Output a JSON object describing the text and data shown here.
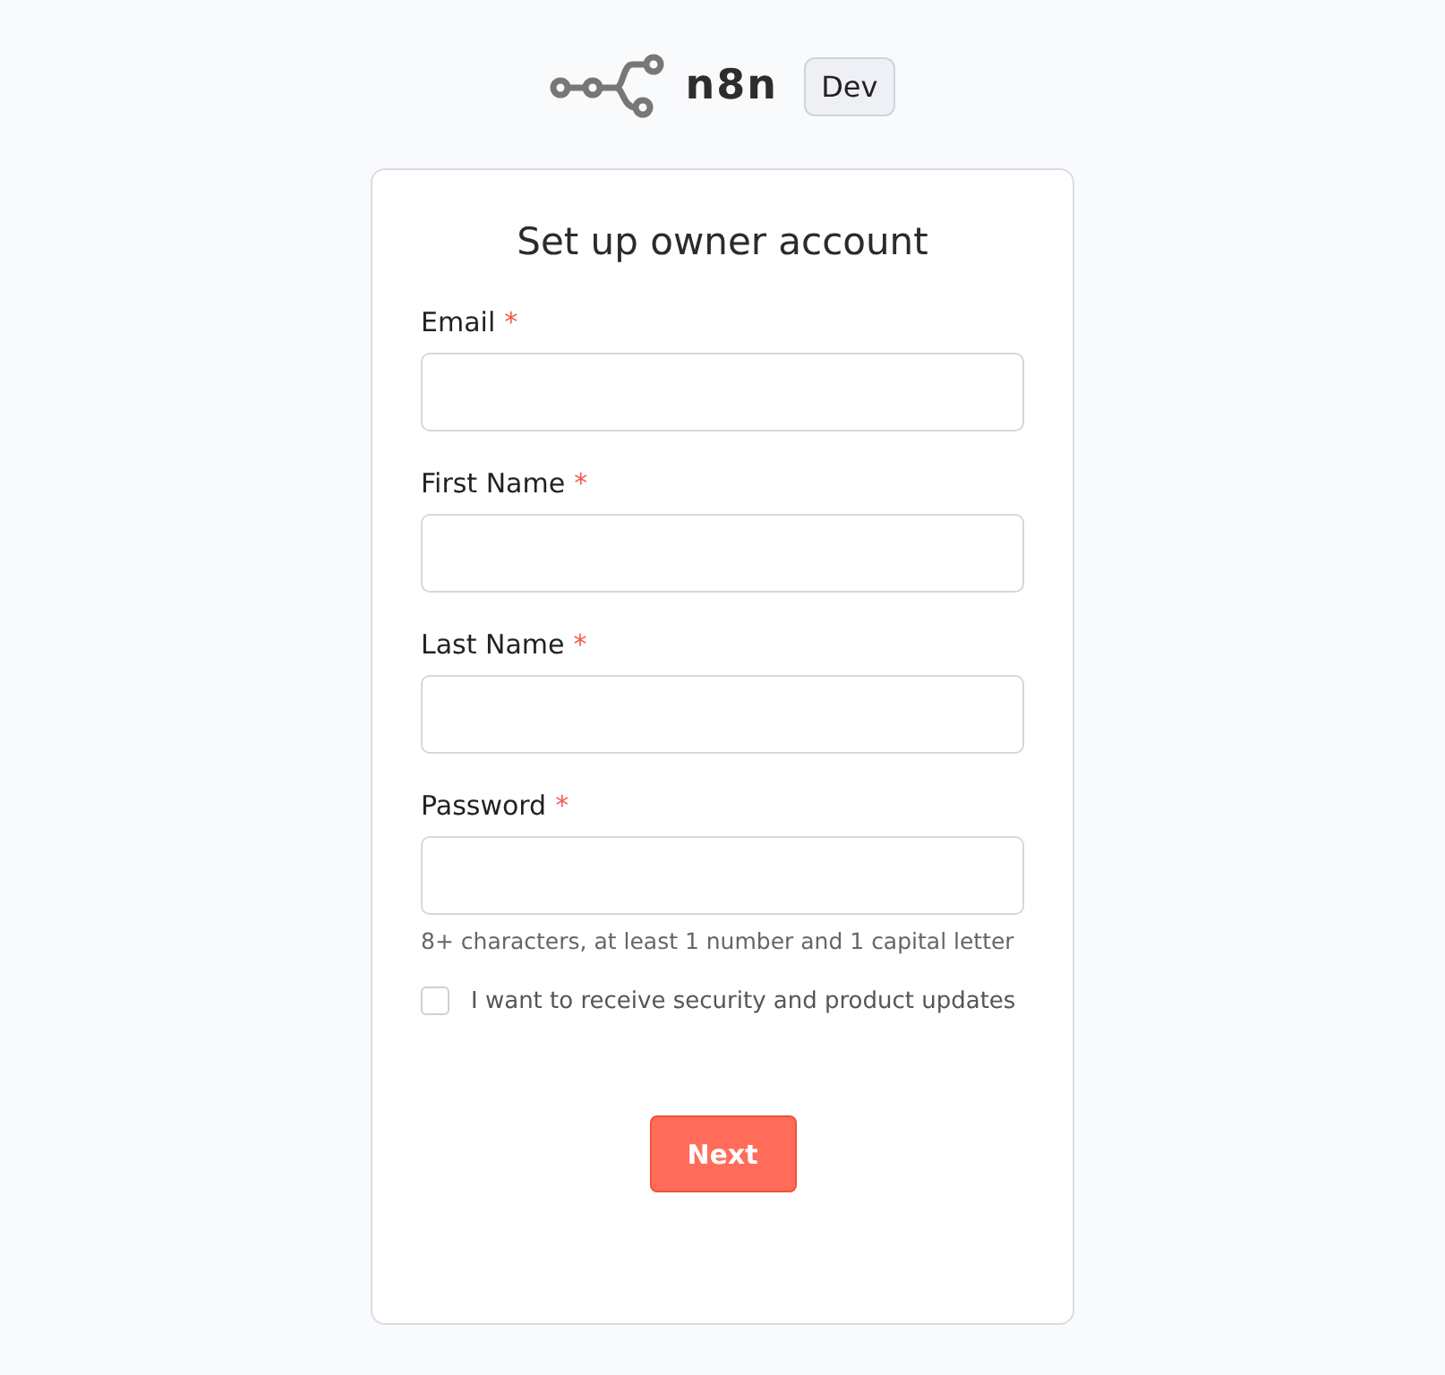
{
  "logo": {
    "name": "n8n",
    "badge": "Dev"
  },
  "form": {
    "title": "Set up owner account",
    "fields": [
      {
        "label": "Email",
        "required_mark": "*"
      },
      {
        "label": "First Name",
        "required_mark": "*"
      },
      {
        "label": "Last Name",
        "required_mark": "*"
      },
      {
        "label": "Password",
        "required_mark": "*",
        "hint": "8+ characters, at least 1 number and 1 capital letter"
      }
    ],
    "checkbox": {
      "label": "I want to receive security and product updates",
      "checked": false
    },
    "button": "Next"
  }
}
